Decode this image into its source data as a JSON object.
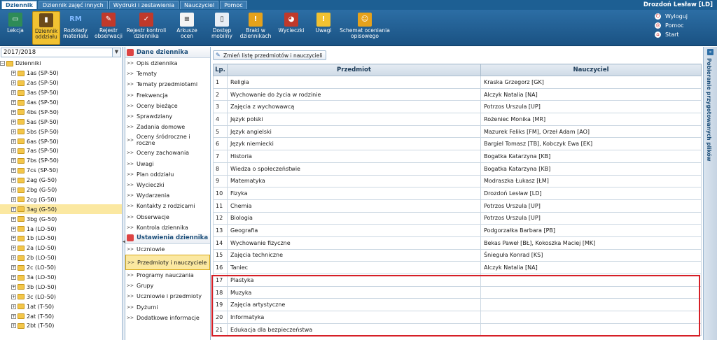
{
  "tabs": [
    "Dziennik",
    "Dziennik zajęć innych",
    "Wydruki i zestawienia",
    "Nauczyciel",
    "Pomoc"
  ],
  "user": "Drozdoń Lesław [LD]",
  "toolbar": [
    {
      "label": "Lekcja",
      "icon": "board-icon",
      "color": "#2e8b57",
      "glyph": "▭"
    },
    {
      "label": "Dziennik oddziału",
      "icon": "journal-icon",
      "color": "#6b4a1a",
      "glyph": "▮"
    },
    {
      "label": "Rozkłady materiału",
      "icon": "rm-icon",
      "color": "transparent",
      "glyph": "RM"
    },
    {
      "label": "Rejestr obserwacji",
      "icon": "register-icon",
      "color": "#c0392b",
      "glyph": "✎"
    },
    {
      "label": "Rejestr kontroli dziennika",
      "icon": "control-icon",
      "color": "#c0392b",
      "glyph": "✓"
    },
    {
      "label": "Arkusze ocen",
      "icon": "sheet-icon",
      "color": "#f4f4f4",
      "glyph": "≡"
    },
    {
      "label": "Dostęp mobilny",
      "icon": "mobile-icon",
      "color": "#e8eef5",
      "glyph": "▯"
    },
    {
      "label": "Braki w dziennikach",
      "icon": "missing-icon",
      "color": "#e6a21b",
      "glyph": "!"
    },
    {
      "label": "Wycieczki",
      "icon": "trip-icon",
      "color": "#c0392b",
      "glyph": "◕"
    },
    {
      "label": "Uwagi",
      "icon": "note-icon",
      "color": "#f1c232",
      "glyph": "!"
    },
    {
      "label": "Schemat oceniania opisowego",
      "icon": "scheme-icon",
      "color": "#e6a21b",
      "glyph": "☺"
    }
  ],
  "rightlinks": [
    "Wyloguj",
    "Pomoc",
    "Start"
  ],
  "year": "2017/2018",
  "tree": {
    "root": "Dzienniki",
    "items": [
      "1as (SP-50)",
      "2as (SP-50)",
      "3as (SP-50)",
      "4as (SP-50)",
      "4bs (SP-50)",
      "5as (SP-50)",
      "5bs (SP-50)",
      "6as (SP-50)",
      "7as (SP-50)",
      "7bs (SP-50)",
      "7cs (SP-50)",
      "2ag (G-50)",
      "2bg (G-50)",
      "2cg (G-50)",
      "3ag (G-50)",
      "3bg (G-50)",
      "1a (LO-50)",
      "1b (LO-50)",
      "2a (LO-50)",
      "2b (LO-50)",
      "2c (LO-50)",
      "3a (LO-50)",
      "3b (LO-50)",
      "3c (LO-50)",
      "1at (T-50)",
      "2at (T-50)",
      "2bt (T-50)"
    ],
    "selected": "3ag (G-50)"
  },
  "nav": {
    "section1": "Dane dziennika",
    "items1": [
      "Opis dziennika",
      "Tematy",
      "Tematy przedmiotami",
      "Frekwencja",
      "Oceny bieżące",
      "Sprawdziany",
      "Zadania domowe",
      "Oceny śródroczne i roczne",
      "Oceny zachowania",
      "Uwagi",
      "Plan oddziału",
      "Wycieczki",
      "Wydarzenia",
      "Kontakty z rodzicami",
      "Obserwacje",
      "Kontrola dziennika"
    ],
    "section2": "Ustawienia dziennika",
    "items2": [
      "Uczniowie",
      "Przedmioty i nauczyciele",
      "Programy nauczania",
      "Grupy",
      "Uczniowie i przedmioty",
      "Dyżurni",
      "Dodatkowe informacje"
    ],
    "selected": "Przedmioty i nauczyciele"
  },
  "change_button": "Zmień listę przedmiotów i nauczycieli",
  "table": {
    "headers": [
      "Lp.",
      "Przedmiot",
      "Nauczyciel"
    ],
    "rows": [
      [
        "1",
        "Religia",
        "Kraska Grzegorz [GK]"
      ],
      [
        "2",
        "Wychowanie do życia w rodzinie",
        "Alczyk Natalia [NA]"
      ],
      [
        "3",
        "Zajęcia z wychowawcą",
        "Potrzos Urszula [UP]"
      ],
      [
        "4",
        "Język polski",
        "Rożeniec Monika [MR]"
      ],
      [
        "5",
        "Język angielski",
        "Mazurek Feliks [FM], Orzeł Adam [AO]"
      ],
      [
        "6",
        "Język niemiecki",
        "Bargiel Tomasz [TB], Kobczyk Ewa [EK]"
      ],
      [
        "7",
        "Historia",
        "Bogatka Katarzyna [KB]"
      ],
      [
        "8",
        "Wiedza o społeczeństwie",
        "Bogatka Katarzyna [KB]"
      ],
      [
        "9",
        "Matematyka",
        "Modraszka Łukasz [ŁM]"
      ],
      [
        "10",
        "Fizyka",
        "Drozdoń Lesław [LD]"
      ],
      [
        "11",
        "Chemia",
        "Potrzos Urszula [UP]"
      ],
      [
        "12",
        "Biologia",
        "Potrzos Urszula [UP]"
      ],
      [
        "13",
        "Geografia",
        "Podgorzałka Barbara [PB]"
      ],
      [
        "14",
        "Wychowanie fizyczne",
        "Bekas Paweł [BŁ], Kokoszka Maciej [MK]"
      ],
      [
        "15",
        "Zajęcia techniczne",
        "Śnieguła Konrad [KS]"
      ],
      [
        "16",
        "Taniec",
        "Alczyk Natalia [NA]"
      ],
      [
        "17",
        "Plastyka",
        ""
      ],
      [
        "18",
        "Muzyka",
        ""
      ],
      [
        "19",
        "Zajęcia artystyczne",
        ""
      ],
      [
        "20",
        "Informatyka",
        ""
      ],
      [
        "21",
        "Edukacja dla bezpieczeństwa",
        ""
      ]
    ]
  },
  "right_panel": "Pobieranie przygotowanych plików"
}
